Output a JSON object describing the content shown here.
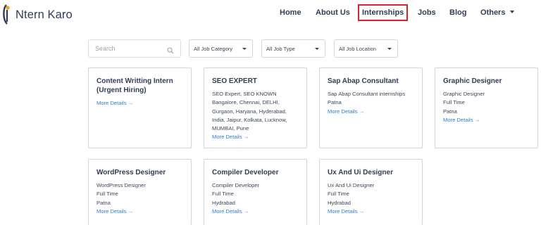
{
  "header": {
    "logo": {
      "text": "Ntern Karo"
    },
    "nav": [
      {
        "label": "Home"
      },
      {
        "label": "About Us"
      },
      {
        "label": "Internships"
      },
      {
        "label": "Jobs"
      },
      {
        "label": "Blog"
      },
      {
        "label": "Others"
      }
    ]
  },
  "filters": {
    "search_placeholder": "Search",
    "category": "All Job Category",
    "type": "All Job Type",
    "location": "All Job Location"
  },
  "cards": [
    {
      "title": "Content Writting Intern (Urgent Hiring)",
      "lines": [],
      "link": "More Details →"
    },
    {
      "title": "SEO EXPERT",
      "lines": [
        "SEO Expert, SEO KNOWN Bangalore, Chennai, DELHI, Gurgaon, Haryana, Hyderabad, India, Jaipur, Kolkata, Lucknow, MUMBAI, Pune"
      ],
      "link": "More Details →"
    },
    {
      "title": "Sap Abap Consultant",
      "lines": [
        "Sap Abap Consultant internships",
        "Patna"
      ],
      "link": "More Details →"
    },
    {
      "title": "Graphic Designer",
      "lines": [
        "Graphic Designer",
        "Full Time",
        "Patna"
      ],
      "link": "More Details →"
    },
    {
      "title": "WordPress Designer",
      "lines": [
        "WordPress Designer",
        "Full Time",
        "Patna"
      ],
      "link": "More Details →"
    },
    {
      "title": "Compiler Developer",
      "lines": [
        "Compiler Developer",
        "Full Time",
        "Hydrabad"
      ],
      "link": "More Details →"
    },
    {
      "title": "Ux And Ui Designer",
      "lines": [
        "Ux And Ui Designer",
        "Full Time",
        "Hydrabad"
      ],
      "link": "More Details →"
    }
  ]
}
